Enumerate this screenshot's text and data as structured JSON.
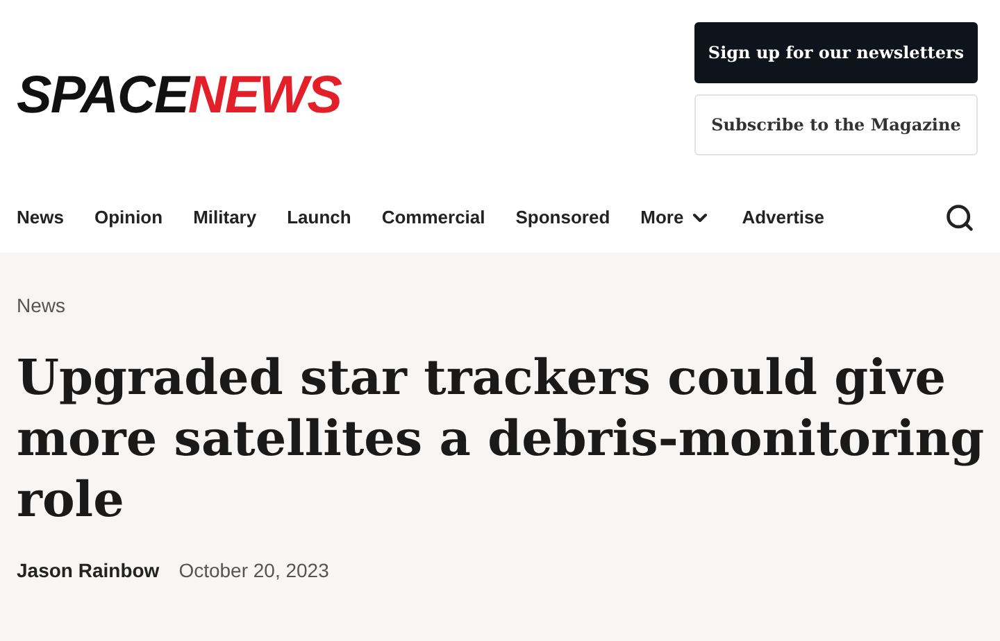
{
  "logo": {
    "part_1": "SPACE",
    "part_2": "NEWS"
  },
  "header_buttons": [
    {
      "label": "Sign up for our newsletters",
      "kind": "primary"
    },
    {
      "label": "Subscribe to the Magazine",
      "kind": "secondary"
    }
  ],
  "nav": [
    {
      "label": "News",
      "kind": "link"
    },
    {
      "label": "Opinion",
      "kind": "link"
    },
    {
      "label": "Military",
      "kind": "link"
    },
    {
      "label": "Launch",
      "kind": "link"
    },
    {
      "label": "Commercial",
      "kind": "link"
    },
    {
      "label": "Sponsored",
      "kind": "link"
    },
    {
      "label": "More",
      "kind": "menu"
    },
    {
      "label": "Advertise",
      "kind": "link"
    }
  ],
  "article": {
    "category": "News",
    "title": "Upgraded star trackers could give more satellites a debris-monitoring role",
    "author": "Jason Rainbow",
    "date": "October 20, 2023"
  }
}
